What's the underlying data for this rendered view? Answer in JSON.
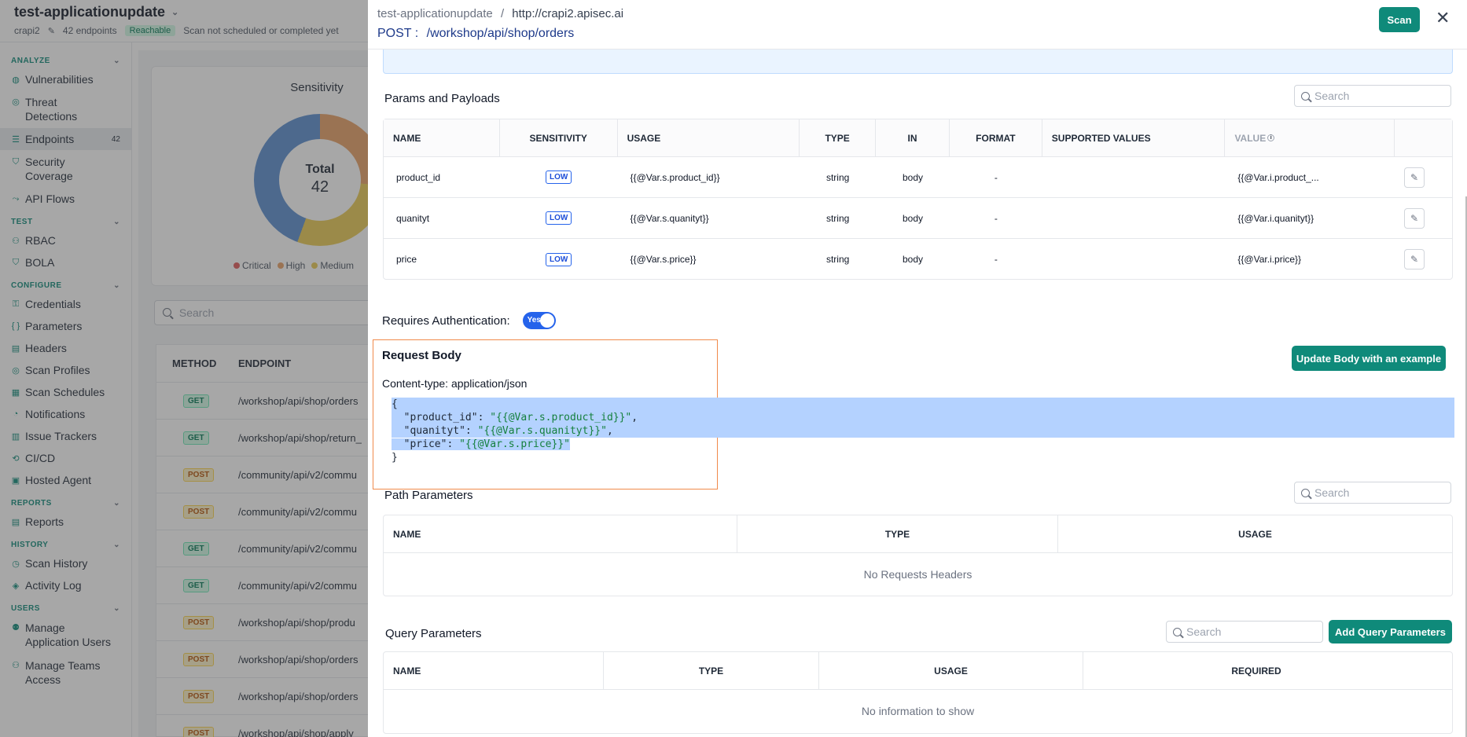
{
  "app": {
    "title": "test-applicationupdate",
    "crawler": "crapi2",
    "endpoints_count": "42 endpoints",
    "reachable": "Reachable",
    "scan_status": "Scan not scheduled or completed yet"
  },
  "sidebar": {
    "sections": [
      {
        "label": "ANALYZE",
        "items": [
          {
            "label": "Vulnerabilities",
            "icon": "shield-alert-icon"
          },
          {
            "label": "Threat Detections",
            "icon": "radar-icon"
          },
          {
            "label": "Endpoints",
            "icon": "list-icon",
            "count": "42",
            "active": true
          },
          {
            "label": "Security Coverage",
            "icon": "shield-icon"
          },
          {
            "label": "API Flows",
            "icon": "flow-icon"
          }
        ]
      },
      {
        "label": "TEST",
        "items": [
          {
            "label": "RBAC",
            "icon": "users-icon"
          },
          {
            "label": "BOLA",
            "icon": "shield-icon"
          }
        ]
      },
      {
        "label": "CONFIGURE",
        "items": [
          {
            "label": "Credentials",
            "icon": "key-icon"
          },
          {
            "label": "Parameters",
            "icon": "braces-icon"
          },
          {
            "label": "Headers",
            "icon": "table-icon"
          },
          {
            "label": "Scan Profiles",
            "icon": "radar-icon"
          },
          {
            "label": "Scan Schedules",
            "icon": "calendar-icon"
          },
          {
            "label": "Notifications",
            "icon": "bell-icon"
          },
          {
            "label": "Issue Trackers",
            "icon": "tracker-icon"
          },
          {
            "label": "CI/CD",
            "icon": "cicd-icon"
          },
          {
            "label": "Hosted Agent",
            "icon": "agent-icon"
          }
        ]
      },
      {
        "label": "REPORTS",
        "items": [
          {
            "label": "Reports",
            "icon": "report-icon"
          }
        ]
      },
      {
        "label": "HISTORY",
        "items": [
          {
            "label": "Scan History",
            "icon": "history-icon"
          },
          {
            "label": "Activity Log",
            "icon": "log-icon"
          }
        ]
      },
      {
        "label": "USERS",
        "items": [
          {
            "label": "Manage Application Users",
            "icon": "user-icon"
          },
          {
            "label": "Manage Teams Access",
            "icon": "team-icon"
          }
        ]
      }
    ]
  },
  "background": {
    "sensitivity_title": "Sensitivity",
    "total_label": "Total",
    "total_value": "42",
    "legend": [
      "Critical",
      "High",
      "Medium"
    ],
    "legend_colors": [
      "#e05b5b",
      "#e8a066",
      "#eacb55"
    ],
    "search_placeholder": "Search",
    "table_headers": [
      "METHOD",
      "ENDPOINT"
    ],
    "rows": [
      {
        "method": "GET",
        "endpoint": "/workshop/api/shop/orders"
      },
      {
        "method": "GET",
        "endpoint": "/workshop/api/shop/return_"
      },
      {
        "method": "POST",
        "endpoint": "/community/api/v2/commu"
      },
      {
        "method": "POST",
        "endpoint": "/community/api/v2/commu"
      },
      {
        "method": "GET",
        "endpoint": "/community/api/v2/commu"
      },
      {
        "method": "GET",
        "endpoint": "/community/api/v2/commu"
      },
      {
        "method": "POST",
        "endpoint": "/workshop/api/shop/produ"
      },
      {
        "method": "POST",
        "endpoint": "/workshop/api/shop/orders"
      },
      {
        "method": "POST",
        "endpoint": "/workshop/api/shop/orders"
      },
      {
        "method": "POST",
        "endpoint": "/workshop/api/shop/apply"
      }
    ]
  },
  "drawer": {
    "breadcrumb_app": "test-applicationupdate",
    "breadcrumb_sep": "/",
    "breadcrumb_host": "http://crapi2.apisec.ai",
    "method": "POST :",
    "path": "/workshop/api/shop/orders",
    "scan_label": "Scan",
    "close": "✕",
    "params": {
      "title": "Params and Payloads",
      "search_placeholder": "Search",
      "headers": [
        "NAME",
        "SENSITIVITY",
        "USAGE",
        "TYPE",
        "IN",
        "FORMAT",
        "SUPPORTED VALUES",
        "VALUE"
      ],
      "rows": [
        {
          "name": "product_id",
          "sensitivity": "LOW",
          "usage": "{{@Var.s.product_id}}",
          "type": "string",
          "in": "body",
          "format": "-",
          "supported": "",
          "value": "{{@Var.i.product_..."
        },
        {
          "name": "quanityt",
          "sensitivity": "LOW",
          "usage": "{{@Var.s.quanityt}}",
          "type": "string",
          "in": "body",
          "format": "-",
          "supported": "",
          "value": "{{@Var.i.quanityt}}"
        },
        {
          "name": "price",
          "sensitivity": "LOW",
          "usage": "{{@Var.s.price}}",
          "type": "string",
          "in": "body",
          "format": "-",
          "supported": "",
          "value": "{{@Var.i.price}}"
        }
      ]
    },
    "auth": {
      "label": "Requires Authentication:",
      "toggle": "Yes"
    },
    "request_body": {
      "title": "Request Body",
      "content_type": "Content-type: application/json",
      "update_button": "Update Body with an example",
      "lines": [
        {
          "text": "{"
        },
        {
          "key": "  \"product_id\"",
          "sep": ": ",
          "val": "\"{{@Var.s.product_id}}\"",
          "tail": ","
        },
        {
          "key": "  \"quanityt\"",
          "sep": ": ",
          "val": "\"{{@Var.s.quanityt}}\"",
          "tail": ","
        },
        {
          "key": "  \"price\"",
          "sep": ": ",
          "val": "\"{{@Var.s.price}}\"",
          "tail": ""
        },
        {
          "text": "}"
        }
      ]
    },
    "path_params": {
      "title": "Path Parameters",
      "search_placeholder": "Search",
      "headers": [
        "NAME",
        "TYPE",
        "USAGE"
      ],
      "empty": "No Requests Headers"
    },
    "query_params": {
      "title": "Query Parameters",
      "search_placeholder": "Search",
      "add_button": "Add Query Parameters",
      "headers": [
        "NAME",
        "TYPE",
        "USAGE",
        "REQUIRED"
      ],
      "empty": "No information to show"
    }
  }
}
